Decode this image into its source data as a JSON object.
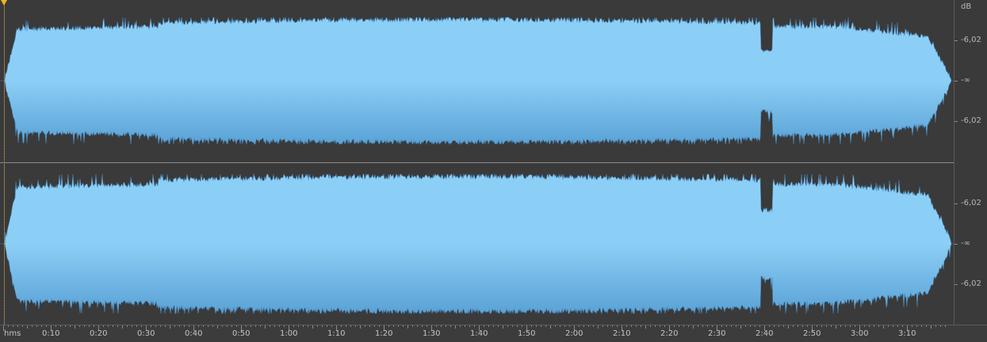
{
  "waveform": {
    "fill_top": "#8ccff6",
    "fill_bottom": "#5aa2d6",
    "edge_color": "#4a86b8",
    "background": "#3a3a3a",
    "duration_seconds": 198,
    "channels": [
      "left",
      "right"
    ]
  },
  "db_ruler": {
    "unit": "dB",
    "channel_labels": [
      "-6,02",
      "-∞",
      "-6,02"
    ]
  },
  "time_ruler": {
    "format_label": "hms",
    "labels": [
      "0:10",
      "0:20",
      "0:30",
      "0:40",
      "0:50",
      "1:00",
      "1:10",
      "1:20",
      "1:30",
      "1:40",
      "1:50",
      "2:00",
      "2:10",
      "2:20",
      "2:30",
      "2:40",
      "2:50",
      "3:00",
      "3:10"
    ]
  },
  "cursor": {
    "color": "#f0b428",
    "time": "0:00"
  }
}
